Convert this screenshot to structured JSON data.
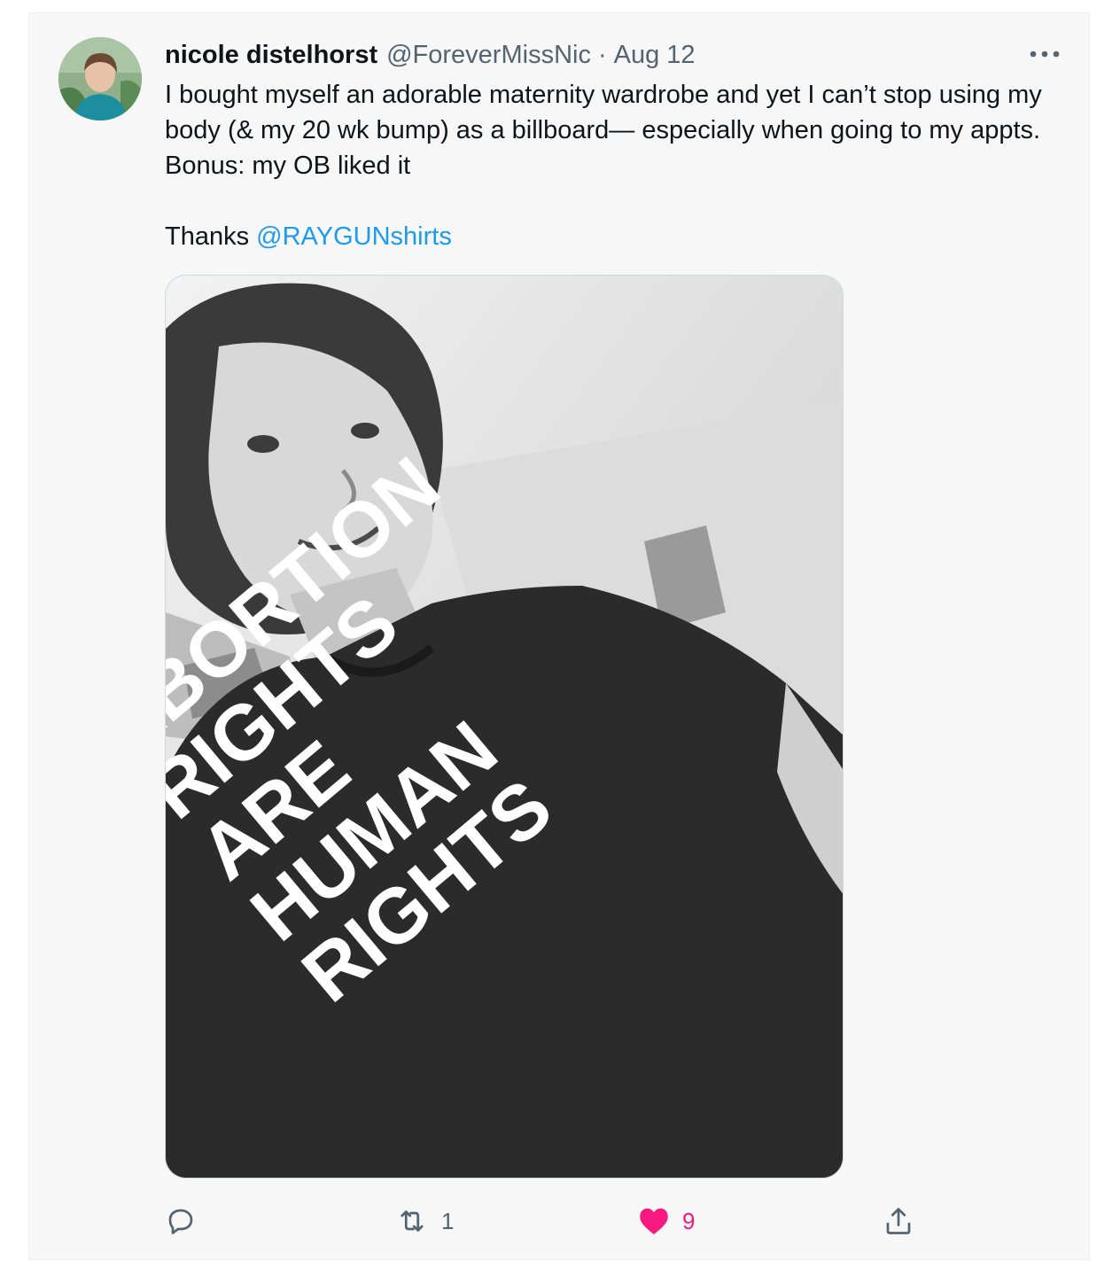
{
  "tweet": {
    "author": {
      "display_name": "nicole distelhorst",
      "handle": "@ForeverMissNic"
    },
    "separator": "·",
    "date": "Aug 12",
    "text_line": "I bought myself an adorable maternity wardrobe and yet I can’t stop using my body (& my 20 wk bump) as a billboard— especially when going to my appts. Bonus: my OB liked it",
    "thanks_prefix": "Thanks ",
    "thanks_mention": "@RAYGUNshirts",
    "media": {
      "shirt_text_lines": [
        "ABORTION",
        "RIGHTS",
        "ARE",
        "HUMAN",
        "RIGHTS"
      ]
    },
    "actions": {
      "reply_icon": "reply-icon",
      "retweet_icon": "retweet-icon",
      "retweet_count": "1",
      "like_icon": "heart-icon",
      "like_count": "9",
      "share_icon": "share-icon"
    }
  },
  "colors": {
    "card_background": "#f7f7f7",
    "primary_text": "#0f1419",
    "secondary_text": "#536471",
    "link": "#1d9bf0",
    "like": "#f91880"
  }
}
